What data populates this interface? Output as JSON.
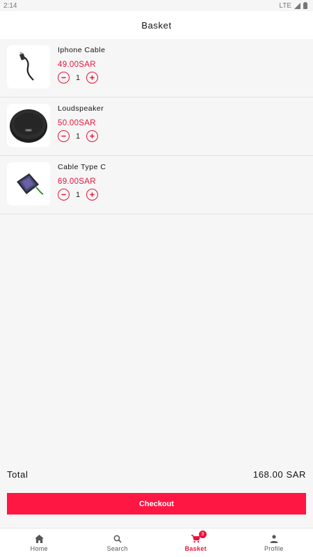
{
  "status_bar": {
    "time": "2:14",
    "network": "LTE"
  },
  "header": {
    "title": "Basket"
  },
  "cart": {
    "items": [
      {
        "name": "Iphone Cable",
        "price": "49.00SAR",
        "quantity": "1"
      },
      {
        "name": "Loudspeaker",
        "price": "50.00SAR",
        "quantity": "1"
      },
      {
        "name": "Cable Type C",
        "price": "69.00SAR",
        "quantity": "1"
      }
    ],
    "total_label": "Total",
    "total_value": "168.00 SAR",
    "checkout_label": "Checkout"
  },
  "tabbar": {
    "tabs": [
      {
        "label": "Home",
        "icon": "home-icon"
      },
      {
        "label": "Search",
        "icon": "search-icon"
      },
      {
        "label": "Basket",
        "icon": "cart-icon",
        "badge": "3",
        "active": true
      },
      {
        "label": "Profile",
        "icon": "person-icon"
      }
    ]
  },
  "colors": {
    "accent": "#e8133a",
    "checkout_bg": "#ff1744",
    "background": "#f6f6f6"
  }
}
